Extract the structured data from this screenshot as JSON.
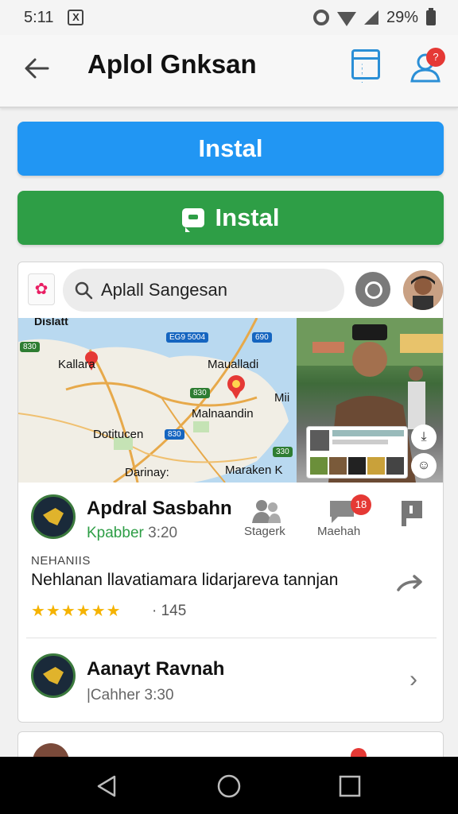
{
  "status_bar": {
    "time": "5:11",
    "sim_icon": "X",
    "battery": "29%"
  },
  "header": {
    "title": "Aplol Gnksan",
    "notification_count": "?"
  },
  "buttons": {
    "install_primary": "Instal",
    "install_secondary": "Instal"
  },
  "search": {
    "value": "Aplall Sangesan"
  },
  "map": {
    "labels": [
      "Dislatt",
      "Kallara",
      "Maualladi",
      "Malnaandin",
      "Mii",
      "Dotitucen",
      "Darinay:",
      "Maraken K"
    ],
    "badges": [
      "830",
      "EG9 5004",
      "690",
      "830",
      "830",
      "330"
    ]
  },
  "rows": [
    {
      "title": "Apdral Sasbahn",
      "sub_prefix": "Kpabber",
      "sub_time": "3:20",
      "actions": [
        "Stagerk",
        "Maehah"
      ],
      "badge": "18"
    },
    {
      "title": "Aanayt Ravnah",
      "sub_prefix": "|Cahher",
      "sub_time": "3:30"
    }
  ],
  "detail": {
    "overline": "NEHANIIS",
    "description": "Nehlanan llavatiamara lidarjareva tannjan",
    "stars": "★★★★★★",
    "count": "· 145"
  },
  "colors": {
    "primary": "#2196f3",
    "success": "#2e9e46",
    "badge": "#e53935"
  }
}
